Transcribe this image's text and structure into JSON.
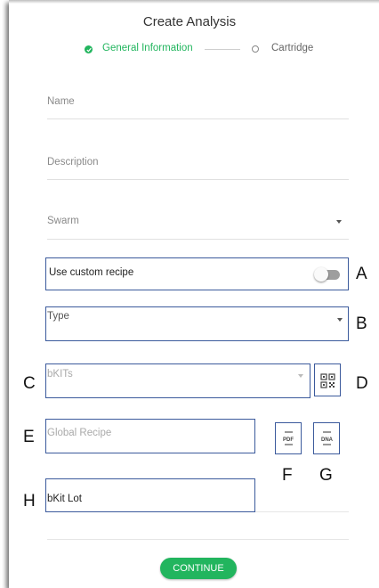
{
  "dialog": {
    "title": "Create Analysis"
  },
  "stepper": {
    "steps": [
      {
        "label": "General Information",
        "state": "active"
      },
      {
        "label": "Cartridge",
        "state": "inactive"
      }
    ]
  },
  "form": {
    "name_placeholder": "Name",
    "description_placeholder": "Description",
    "swarm_placeholder": "Swarm",
    "custom_recipe_label": "Use custom recipe",
    "custom_recipe_enabled": false,
    "type_placeholder": "Type",
    "bkits_placeholder": "bKITs",
    "global_recipe_placeholder": "Global Recipe",
    "bkit_lot_placeholder": "bKit Lot"
  },
  "icons": {
    "qr": "qr-code-icon",
    "pdf": "pdf-icon",
    "dna": "dna-icon"
  },
  "icon_text": {
    "pdf": "PDF",
    "dna": "DNA"
  },
  "annotations": {
    "A": "A",
    "B": "B",
    "C": "C",
    "D": "D",
    "E": "E",
    "F": "F",
    "G": "G",
    "H": "H"
  },
  "actions": {
    "continue_label": "CONTINUE"
  },
  "colors": {
    "accent": "#22b55e",
    "highlight_border": "#3b5a9c"
  }
}
